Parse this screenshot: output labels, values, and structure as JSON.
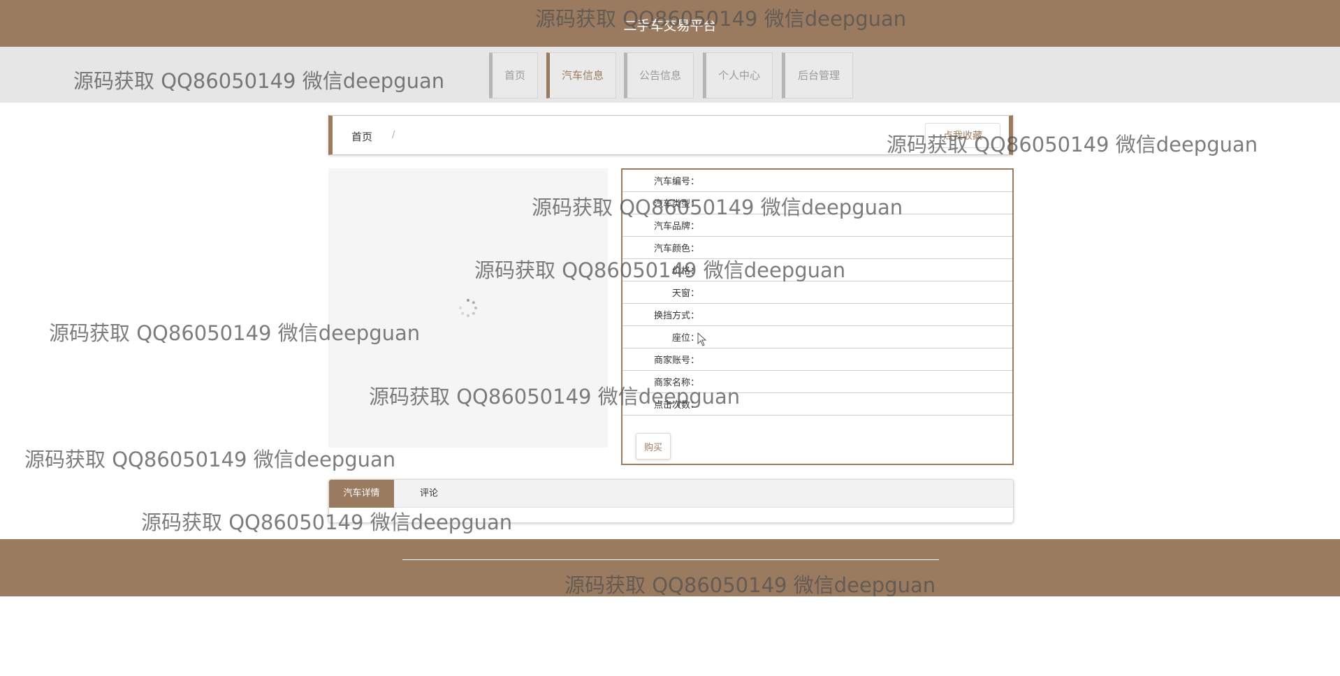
{
  "site": {
    "title": "二手车交易平台"
  },
  "nav": {
    "items": [
      {
        "label": "首页",
        "active": false
      },
      {
        "label": "汽车信息",
        "active": true
      },
      {
        "label": "公告信息",
        "active": false
      },
      {
        "label": "个人中心",
        "active": false
      },
      {
        "label": "后台管理",
        "active": false
      }
    ]
  },
  "breadcrumb": {
    "home": "首页",
    "separator": "/"
  },
  "actions": {
    "favorite_label": "点我收藏",
    "buy_label": "购买"
  },
  "details": {
    "fields": [
      {
        "label": "汽车编号：",
        "value": ""
      },
      {
        "label": "汽车类型：",
        "value": ""
      },
      {
        "label": "汽车品牌：",
        "value": ""
      },
      {
        "label": "汽车颜色：",
        "value": ""
      },
      {
        "label": "价格：",
        "value": ""
      },
      {
        "label": "天窗：",
        "value": ""
      },
      {
        "label": "换挡方式：",
        "value": ""
      },
      {
        "label": "座位：",
        "value": ""
      },
      {
        "label": "商家账号：",
        "value": ""
      },
      {
        "label": "商家名称：",
        "value": ""
      },
      {
        "label": "点击次数：",
        "value": ""
      }
    ]
  },
  "tabs": [
    {
      "label": "汽车详情",
      "active": true
    },
    {
      "label": "评论",
      "active": false
    }
  ],
  "watermark": {
    "text": "源码获取 QQ86050149 微信deepguan"
  },
  "colors": {
    "brand": "#9b7b60",
    "nav_bg": "#e6e6e6",
    "panel_bg": "#f5f5f5"
  }
}
